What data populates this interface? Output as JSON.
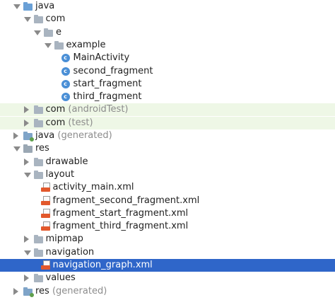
{
  "rows": [
    {
      "label": "java",
      "suffix": "",
      "indent": 0,
      "arrow": "down",
      "icon": "folder-blue",
      "bg": ""
    },
    {
      "label": "com",
      "suffix": "",
      "indent": 1,
      "arrow": "down",
      "icon": "folder",
      "bg": ""
    },
    {
      "label": "e",
      "suffix": "",
      "indent": 2,
      "arrow": "down",
      "icon": "folder",
      "bg": ""
    },
    {
      "label": "example",
      "suffix": "",
      "indent": 3,
      "arrow": "down",
      "icon": "folder",
      "bg": ""
    },
    {
      "label": "MainActivity",
      "suffix": "",
      "indent": 4,
      "arrow": "",
      "icon": "class",
      "bg": ""
    },
    {
      "label": "second_fragment",
      "suffix": "",
      "indent": 4,
      "arrow": "",
      "icon": "class",
      "bg": ""
    },
    {
      "label": "start_fragment",
      "suffix": "",
      "indent": 4,
      "arrow": "",
      "icon": "class",
      "bg": ""
    },
    {
      "label": "third_fragment",
      "suffix": "",
      "indent": 4,
      "arrow": "",
      "icon": "class",
      "bg": ""
    },
    {
      "label": "com",
      "suffix": "(androidTest)",
      "indent": 1,
      "arrow": "right",
      "icon": "folder",
      "bg": "test"
    },
    {
      "label": "com",
      "suffix": "(test)",
      "indent": 1,
      "arrow": "right",
      "icon": "folder",
      "bg": "test"
    },
    {
      "label": "java",
      "suffix": "(generated)",
      "indent": 0,
      "arrow": "right",
      "icon": "folder-gen",
      "bg": ""
    },
    {
      "label": "res",
      "suffix": "",
      "indent": 0,
      "arrow": "down",
      "icon": "folder-res",
      "bg": ""
    },
    {
      "label": "drawable",
      "suffix": "",
      "indent": 1,
      "arrow": "right",
      "icon": "folder",
      "bg": ""
    },
    {
      "label": "layout",
      "suffix": "",
      "indent": 1,
      "arrow": "down",
      "icon": "folder",
      "bg": ""
    },
    {
      "label": "activity_main.xml",
      "suffix": "",
      "indent": 2,
      "arrow": "",
      "icon": "xml",
      "bg": ""
    },
    {
      "label": "fragment_second_fragment.xml",
      "suffix": "",
      "indent": 2,
      "arrow": "",
      "icon": "xml",
      "bg": ""
    },
    {
      "label": "fragment_start_fragment.xml",
      "suffix": "",
      "indent": 2,
      "arrow": "",
      "icon": "xml",
      "bg": ""
    },
    {
      "label": "fragment_third_fragment.xml",
      "suffix": "",
      "indent": 2,
      "arrow": "",
      "icon": "xml",
      "bg": ""
    },
    {
      "label": "mipmap",
      "suffix": "",
      "indent": 1,
      "arrow": "right",
      "icon": "folder",
      "bg": ""
    },
    {
      "label": "navigation",
      "suffix": "",
      "indent": 1,
      "arrow": "down",
      "icon": "folder",
      "bg": ""
    },
    {
      "label": "navigation_graph.xml",
      "suffix": "",
      "indent": 2,
      "arrow": "",
      "icon": "xml",
      "bg": "selected"
    },
    {
      "label": "values",
      "suffix": "",
      "indent": 1,
      "arrow": "right",
      "icon": "folder",
      "bg": ""
    },
    {
      "label": "res",
      "suffix": "(generated)",
      "indent": 0,
      "arrow": "right",
      "icon": "folder-gen",
      "bg": ""
    }
  ],
  "colors": {
    "selection": "#2f66c9",
    "test_background": "#eef7e6",
    "class_icon": "#4a8fd6",
    "xml_icon": "#e2582c"
  }
}
